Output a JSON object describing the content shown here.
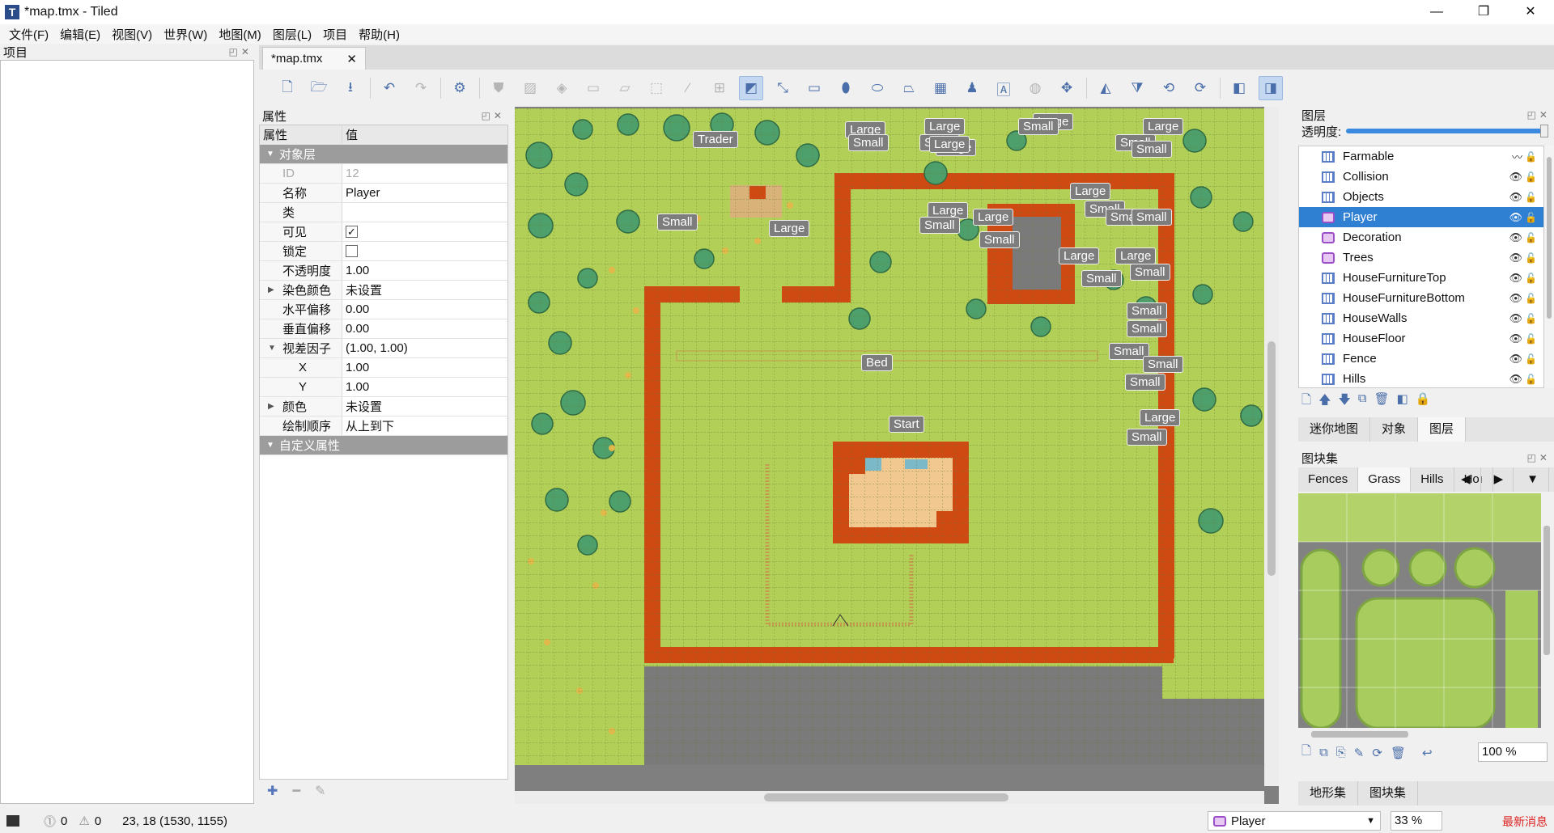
{
  "window": {
    "title": "*map.tmx - Tiled",
    "minimize": "—",
    "maximize": "❐",
    "close": "✕"
  },
  "menu": [
    "文件(F)",
    "编辑(E)",
    "视图(V)",
    "世界(W)",
    "地图(M)",
    "图层(L)",
    "项目",
    "帮助(H)"
  ],
  "project_panel": {
    "title": "项目"
  },
  "tab": {
    "label": "*map.tmx",
    "close": "✕"
  },
  "properties": {
    "title": "属性",
    "col_name": "属性",
    "col_value": "值",
    "group_object_layer": "对象层",
    "rows": [
      {
        "key": "ID",
        "value": "12"
      },
      {
        "key": "名称",
        "value": "Player"
      },
      {
        "key": "类",
        "value": ""
      },
      {
        "key": "可见",
        "value": "✓"
      },
      {
        "key": "锁定",
        "value": ""
      },
      {
        "key": "不透明度",
        "value": "1.00"
      },
      {
        "key": "染色颜色",
        "value": "未设置"
      },
      {
        "key": "水平偏移",
        "value": "0.00"
      },
      {
        "key": "垂直偏移",
        "value": "0.00"
      },
      {
        "key": "视差因子",
        "value": "(1.00, 1.00)"
      },
      {
        "key": "X",
        "value": "1.00"
      },
      {
        "key": "Y",
        "value": "1.00"
      },
      {
        "key": "颜色",
        "value": "未设置"
      },
      {
        "key": "绘制顺序",
        "value": "从上到下"
      }
    ],
    "group_custom": "自定义属性"
  },
  "map_labels": [
    "Trader",
    "Large",
    "Small",
    "Large",
    "Small",
    "Large",
    "Large",
    "Small",
    "Large",
    "Small",
    "Small",
    "Large",
    "Large",
    "Small",
    "Large",
    "Small",
    "Small",
    "Small",
    "Large",
    "Small",
    "Small",
    "Small",
    "Small",
    "Small",
    "Small",
    "Small",
    "Large",
    "Small",
    "Bed",
    "Start",
    "Small",
    "Large",
    "Large",
    "Large",
    "Small"
  ],
  "layers_panel": {
    "title": "图层",
    "opacity_label": "透明度:",
    "layers": [
      {
        "name": "Farmable",
        "type": "tile"
      },
      {
        "name": "Collision",
        "type": "tile"
      },
      {
        "name": "Objects",
        "type": "tile"
      },
      {
        "name": "Player",
        "type": "object",
        "selected": true
      },
      {
        "name": "Decoration",
        "type": "object"
      },
      {
        "name": "Trees",
        "type": "object"
      },
      {
        "name": "HouseFurnitureTop",
        "type": "tile"
      },
      {
        "name": "HouseFurnitureBottom",
        "type": "tile"
      },
      {
        "name": "HouseWalls",
        "type": "tile"
      },
      {
        "name": "HouseFloor",
        "type": "tile"
      },
      {
        "name": "Fence",
        "type": "tile"
      },
      {
        "name": "Hills",
        "type": "tile"
      }
    ],
    "tabs": [
      "迷你地图",
      "对象",
      "图层"
    ]
  },
  "tilesets_panel": {
    "title": "图块集",
    "tabs": [
      "Fences",
      "Grass",
      "Hills",
      "Hoı"
    ],
    "zoom": "100 %",
    "bottom_tabs": [
      "地形集",
      "图块集"
    ]
  },
  "status": {
    "errors": "0",
    "warnings": "0",
    "coords": "23, 18 (1530, 1155)",
    "layer": "Player",
    "zoom": "33 %",
    "news": "最新消息"
  },
  "colors": {
    "selection": "#2f7fd3",
    "wall": "#cf4a12",
    "grass": "#b2cf57",
    "floor": "#f0c890",
    "stone": "#7a7a7a"
  }
}
